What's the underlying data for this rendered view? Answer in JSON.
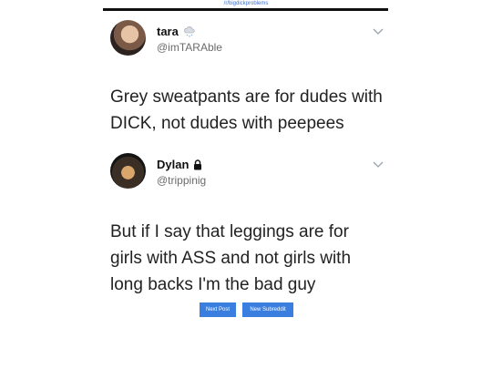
{
  "source": {
    "label": "/r/bigdickproblems"
  },
  "tweets": [
    {
      "name": "tara",
      "handle": "@imTARAble",
      "text": "Grey sweatpants are for dudes with DICK, not dudes with peepees",
      "name_icon": "snow-cloud-icon"
    },
    {
      "name": "Dylan",
      "handle": "@trippinig",
      "text": "But if I say that leggings are for girls with ASS and not girls with long backs I'm the bad guy",
      "name_icon": "lock-icon"
    }
  ],
  "buttons": {
    "next_post": "Next Post",
    "new_subreddit": "New Subreddit"
  },
  "colors": {
    "link": "#3b6fd8",
    "button": "#3a7fe0",
    "text": "#222222",
    "handle": "#6b6b6b"
  }
}
